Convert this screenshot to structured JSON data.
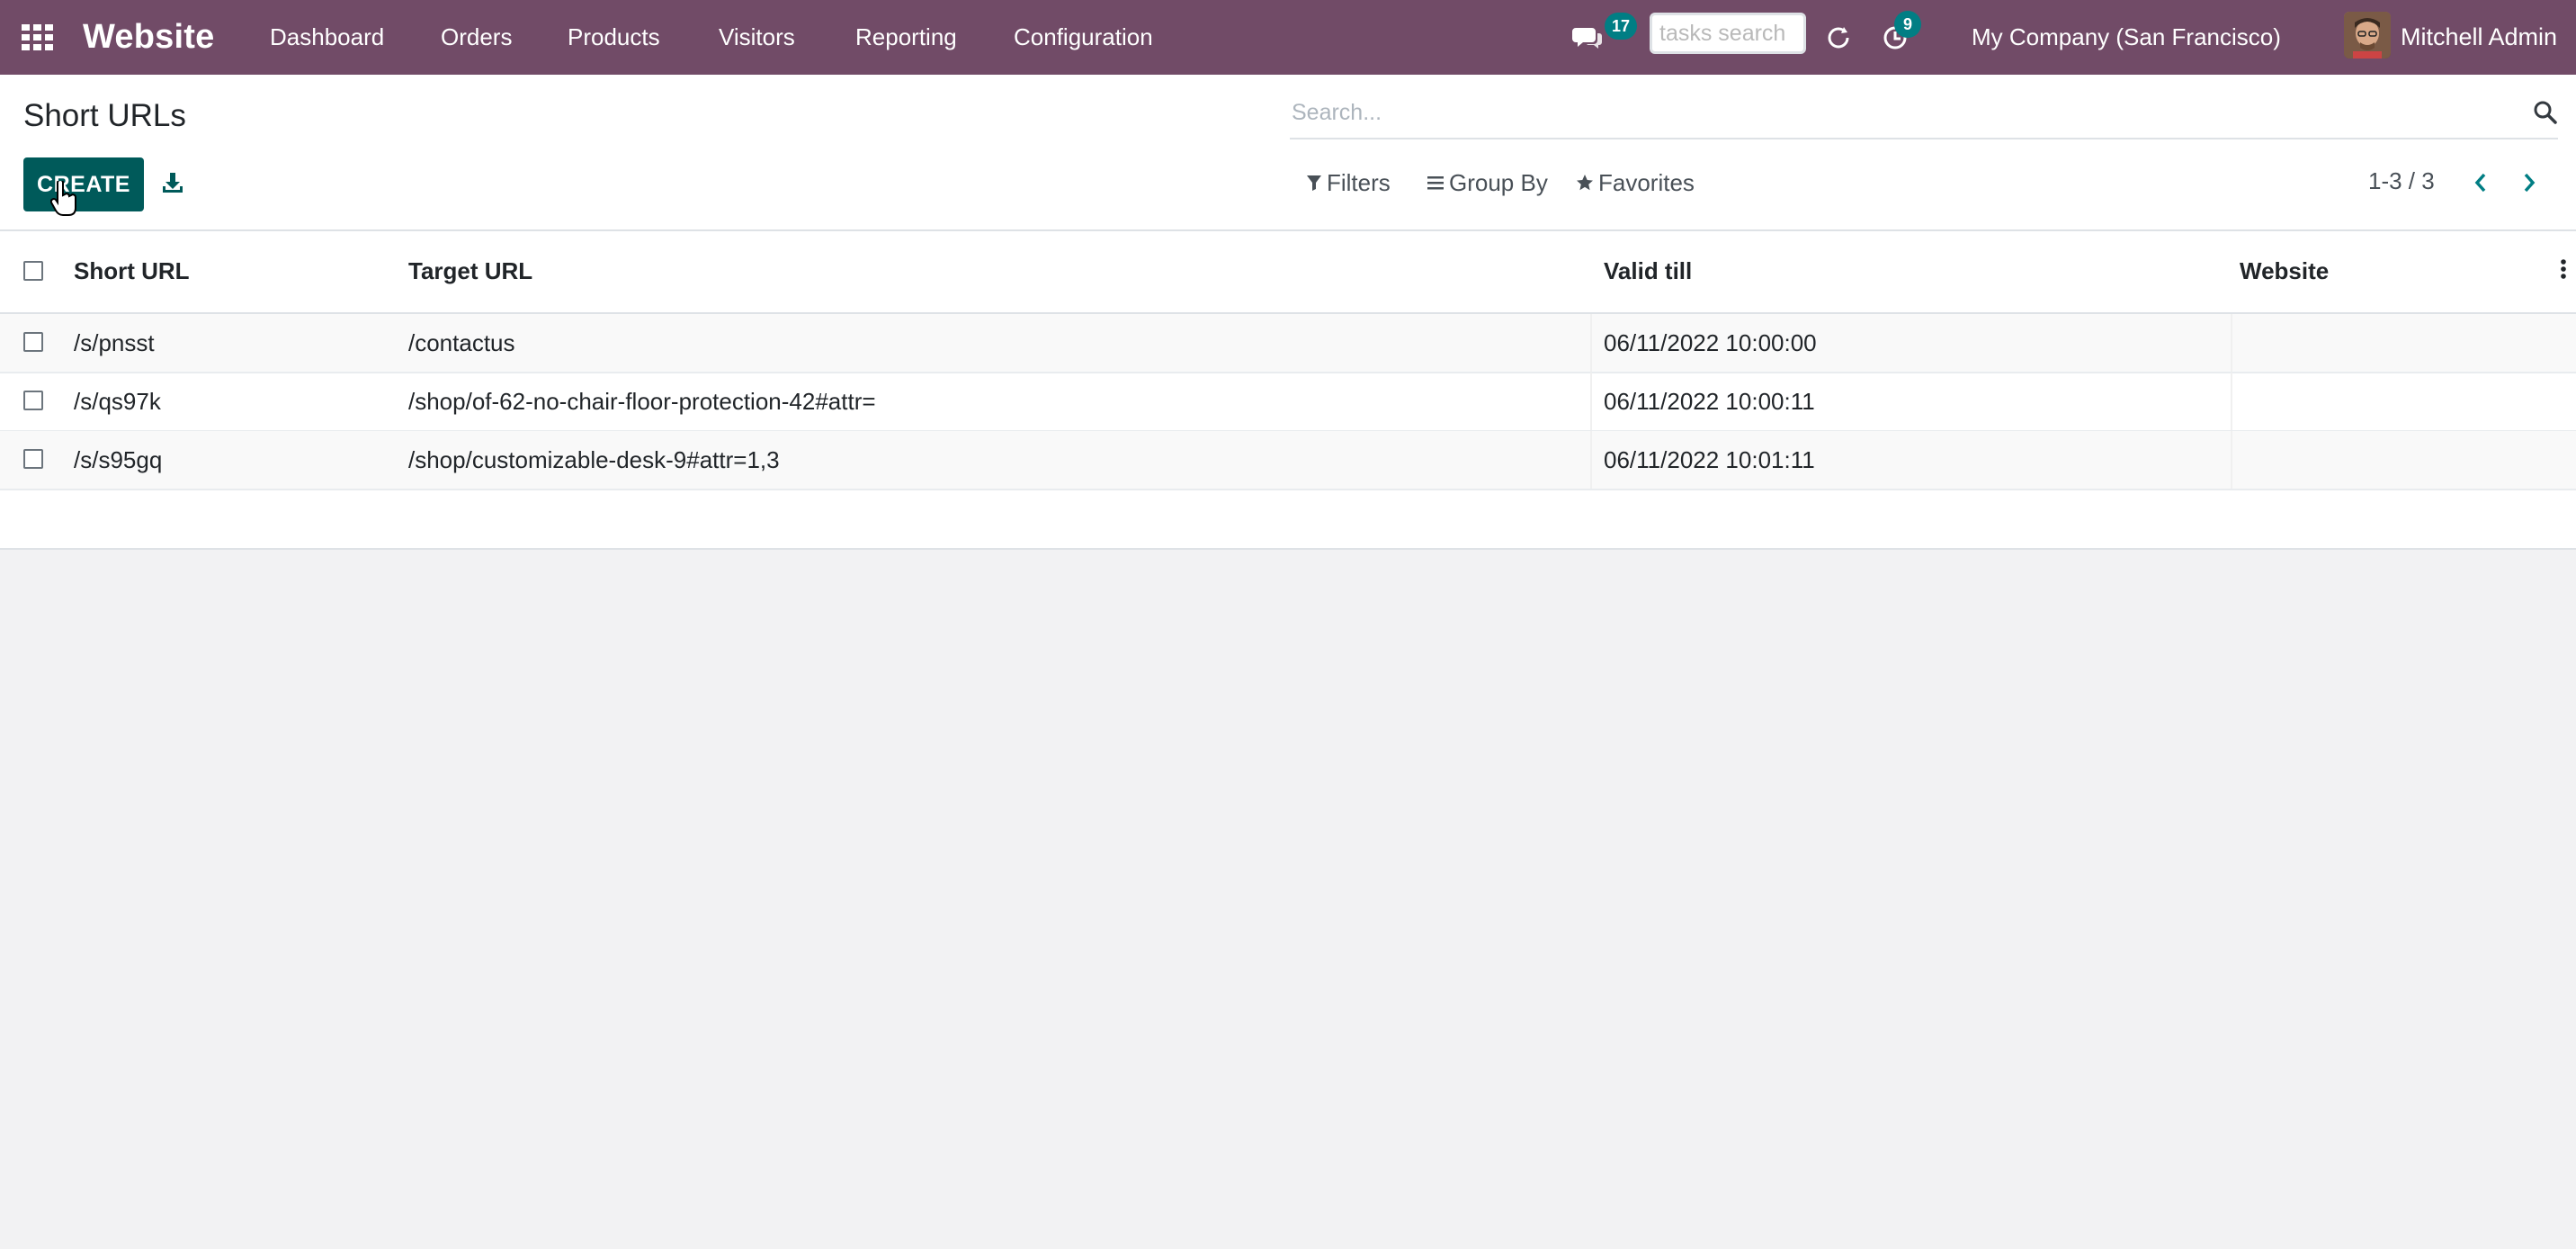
{
  "navbar": {
    "brand": "Website",
    "menu": [
      "Dashboard",
      "Orders",
      "Products",
      "Visitors",
      "Reporting",
      "Configuration"
    ],
    "messages_count": "17",
    "tasks_search_placeholder": "tasks search",
    "activities_count": "9",
    "company": "My Company (San Francisco)",
    "user": "Mitchell Admin",
    "bg_color": "#714b67"
  },
  "control_panel": {
    "title": "Short URLs",
    "create_label": "CREATE",
    "search_placeholder": "Search...",
    "filters_label": "Filters",
    "group_by_label": "Group By",
    "favorites_label": "Favorites",
    "pager": "1-3 / 3"
  },
  "table": {
    "columns": [
      "Short URL",
      "Target URL",
      "Valid till",
      "Website"
    ],
    "rows": [
      {
        "short_url": "/s/pnsst",
        "target_url": "/contactus",
        "valid_till": "06/11/2022 10:00:00",
        "website": ""
      },
      {
        "short_url": "/s/qs97k",
        "target_url": "/shop/of-62-no-chair-floor-protection-42#attr=",
        "valid_till": "06/11/2022 10:00:11",
        "website": ""
      },
      {
        "short_url": "/s/s95gq",
        "target_url": "/shop/customizable-desk-9#attr=1,3",
        "valid_till": "06/11/2022 10:01:11",
        "website": ""
      }
    ]
  },
  "colors": {
    "primary": "#005a5a",
    "badge": "#017e84"
  }
}
